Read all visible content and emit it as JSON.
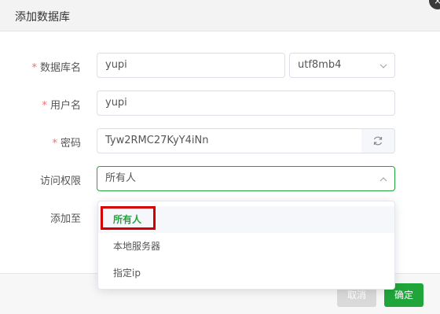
{
  "dialog": {
    "title": "添加数据库",
    "close_icon": "×"
  },
  "form": {
    "db_name_label": "数据库名",
    "db_name_value": "yupi",
    "charset_value": "utf8mb4",
    "user_label": "用户名",
    "user_value": "yupi",
    "password_label": "密码",
    "password_value": "Tyw2RMC27KyY4iNn",
    "access_label": "访问权限",
    "access_value": "所有人",
    "add_to_label": "添加至",
    "required_mark": "*"
  },
  "dropdown": {
    "options": [
      "所有人",
      "本地服务器",
      "指定ip"
    ],
    "selected_index": 0
  },
  "footer": {
    "cancel_label": "取消",
    "confirm_label": "确定"
  },
  "colors": {
    "accent": "#20a53a",
    "required": "#f56c6c",
    "highlight": "#d40000"
  }
}
